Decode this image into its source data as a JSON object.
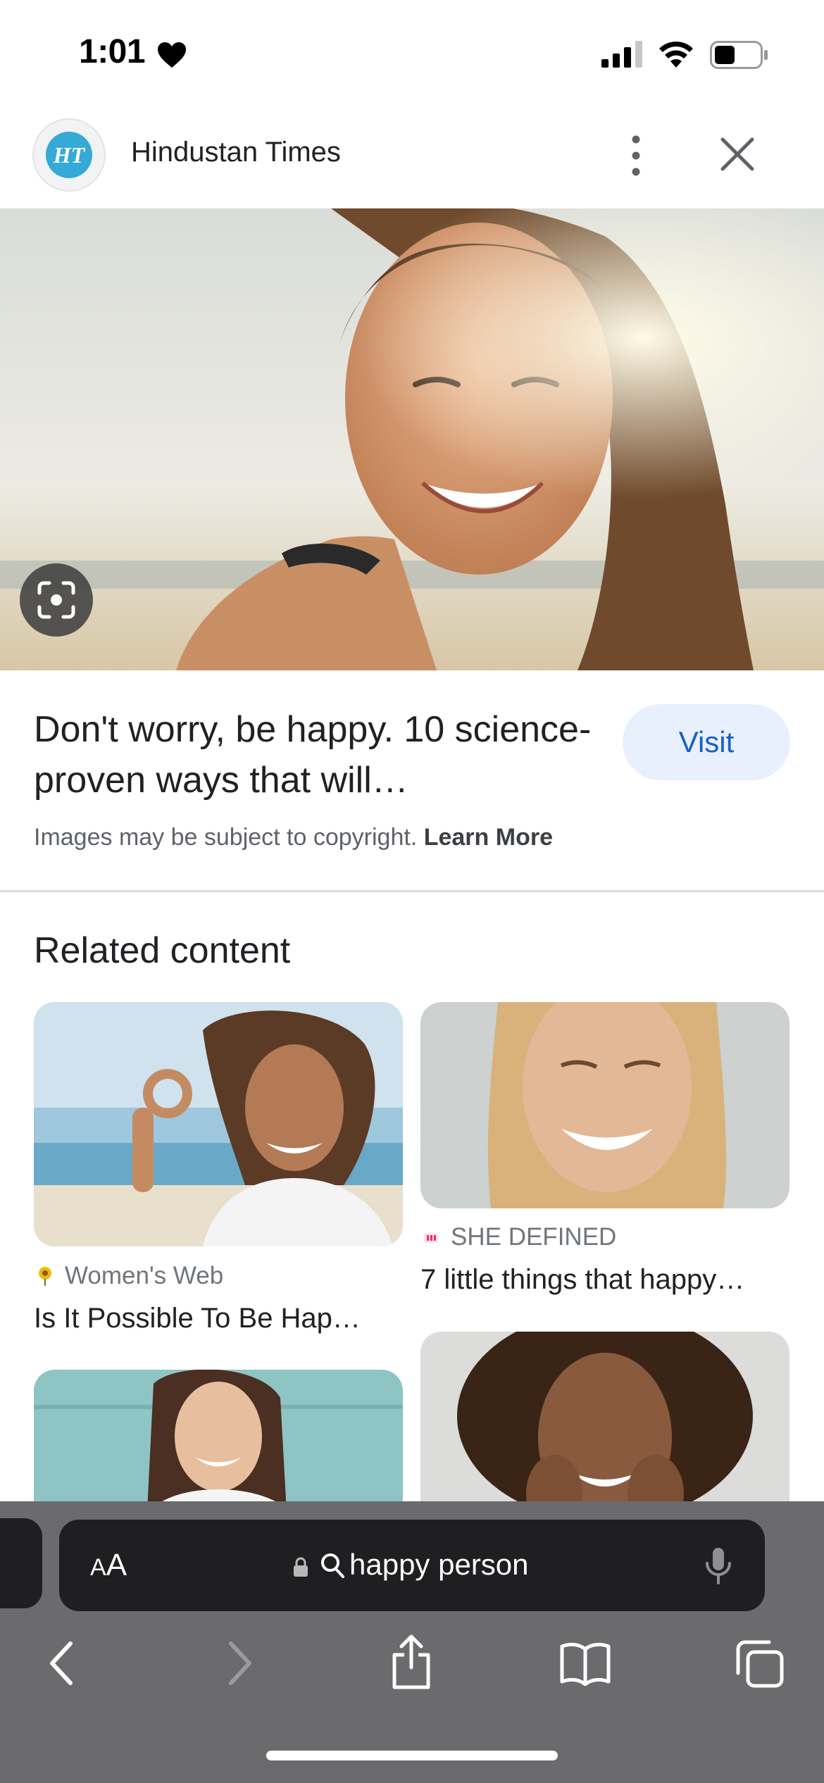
{
  "status_bar": {
    "time": "1:01"
  },
  "source": {
    "logo_text": "HT",
    "name": "Hindustan Times"
  },
  "result": {
    "title": "Don't worry, be happy. 10 science-proven ways that will…",
    "visit_label": "Visit",
    "copyright_text": "Images may be subject to copyright.",
    "learn_more_label": "Learn More"
  },
  "related": {
    "heading": "Related content",
    "cards": [
      {
        "source": "Women's Web",
        "title": "Is It Possible To Be Hap…"
      },
      {
        "source": "SHE DEFINED",
        "title": "7 little things that happy…"
      }
    ]
  },
  "browser": {
    "text_size_label_small": "A",
    "text_size_label_large": "A",
    "address_text": "happy person"
  },
  "colors": {
    "visit_bg": "#e8f0fe",
    "visit_text": "#1a5fc7",
    "chrome_bg": "#6b6b6d",
    "address_bar_bg": "#1f1f21"
  },
  "icons": [
    "heart-icon",
    "signal-icon",
    "wifi-icon",
    "battery-icon",
    "more-icon",
    "close-icon",
    "lens-icon",
    "lock-icon",
    "search-icon",
    "mic-icon",
    "back-icon",
    "forward-icon",
    "share-icon",
    "bookmarks-icon",
    "tabs-icon"
  ]
}
